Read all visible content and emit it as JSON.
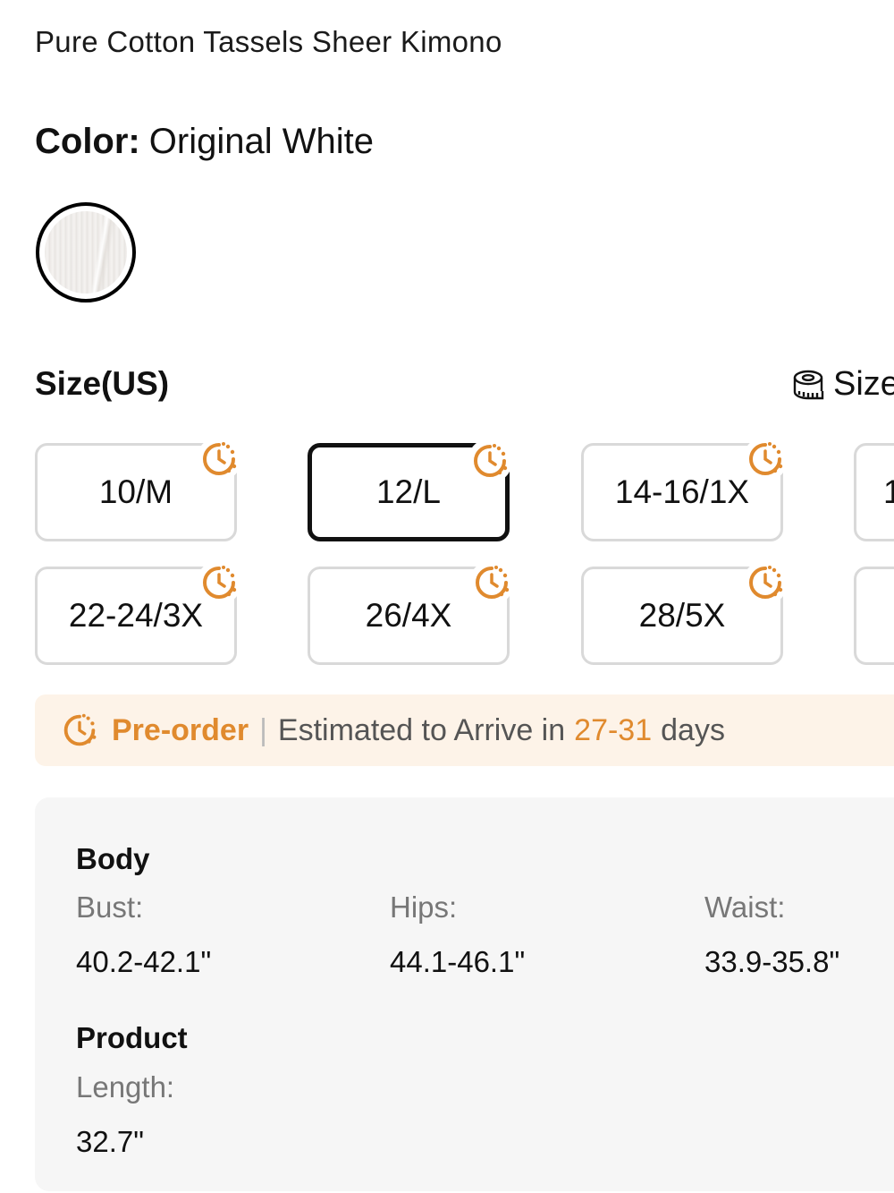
{
  "product": {
    "title": "Pure Cotton Tassels Sheer Kimono"
  },
  "color": {
    "label": "Color:",
    "value": "Original White"
  },
  "size": {
    "heading": "Size(US)",
    "guide_label": "Size",
    "options": [
      {
        "label": "10/M"
      },
      {
        "label": "12/L",
        "selected": true
      },
      {
        "label": "14-16/1X"
      },
      {
        "label": "1"
      },
      {
        "label": "22-24/3X"
      },
      {
        "label": "26/4X"
      },
      {
        "label": "28/5X"
      },
      {
        "label": ""
      }
    ]
  },
  "preorder": {
    "label": "Pre-order",
    "separator": "|",
    "text": "Estimated to Arrive in",
    "range": "27-31",
    "unit": "days"
  },
  "measurements": {
    "body": {
      "heading": "Body",
      "items": [
        {
          "label": "Bust:",
          "value": "40.2-42.1\""
        },
        {
          "label": "Hips:",
          "value": "44.1-46.1\""
        },
        {
          "label": "Waist:",
          "value": "33.9-35.8\""
        }
      ]
    },
    "product": {
      "heading": "Product",
      "items": [
        {
          "label": "Length:",
          "value": "32.7\""
        }
      ]
    }
  },
  "colors": {
    "accent": "#e08a2e",
    "preorder_bg": "#fdf3e8",
    "selected_border": "#111111"
  }
}
